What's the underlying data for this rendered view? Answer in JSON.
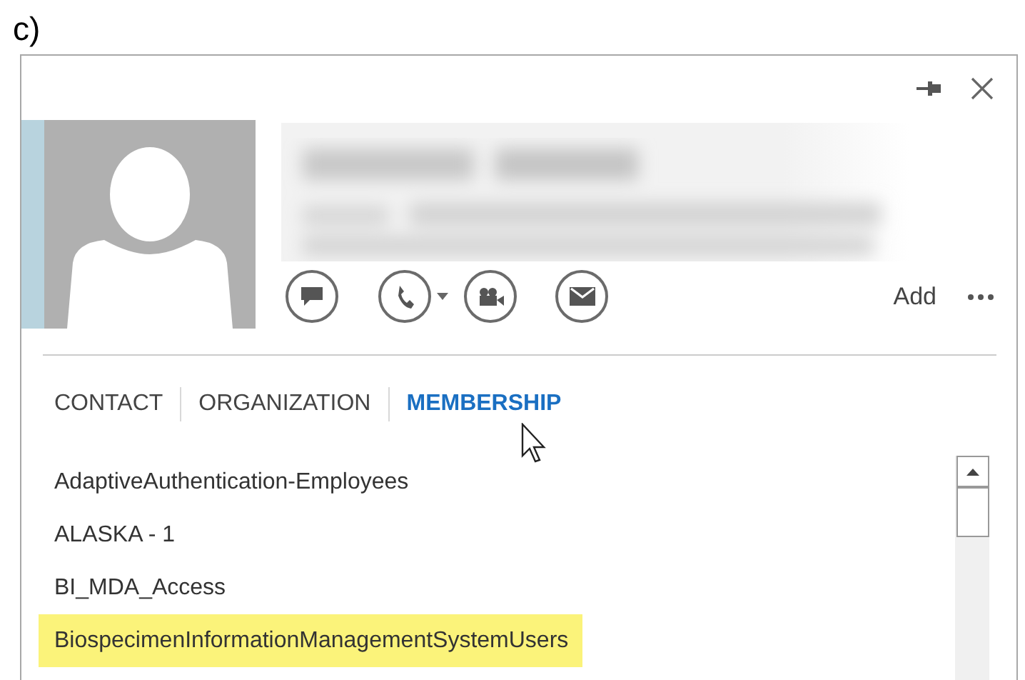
{
  "caption": "c)",
  "actions": {
    "add_label": "Add"
  },
  "tabs": [
    {
      "label": "CONTACT",
      "selected": false
    },
    {
      "label": "ORGANIZATION",
      "selected": false
    },
    {
      "label": "MEMBERSHIP",
      "selected": true
    }
  ],
  "memberships": [
    {
      "name": "AdaptiveAuthentication-Employees",
      "highlighted": false
    },
    {
      "name": "ALASKA - 1",
      "highlighted": false
    },
    {
      "name": "BI_MDA_Access",
      "highlighted": false
    },
    {
      "name": "BiospecimenInformationManagementSystemUsers",
      "highlighted": true
    }
  ]
}
